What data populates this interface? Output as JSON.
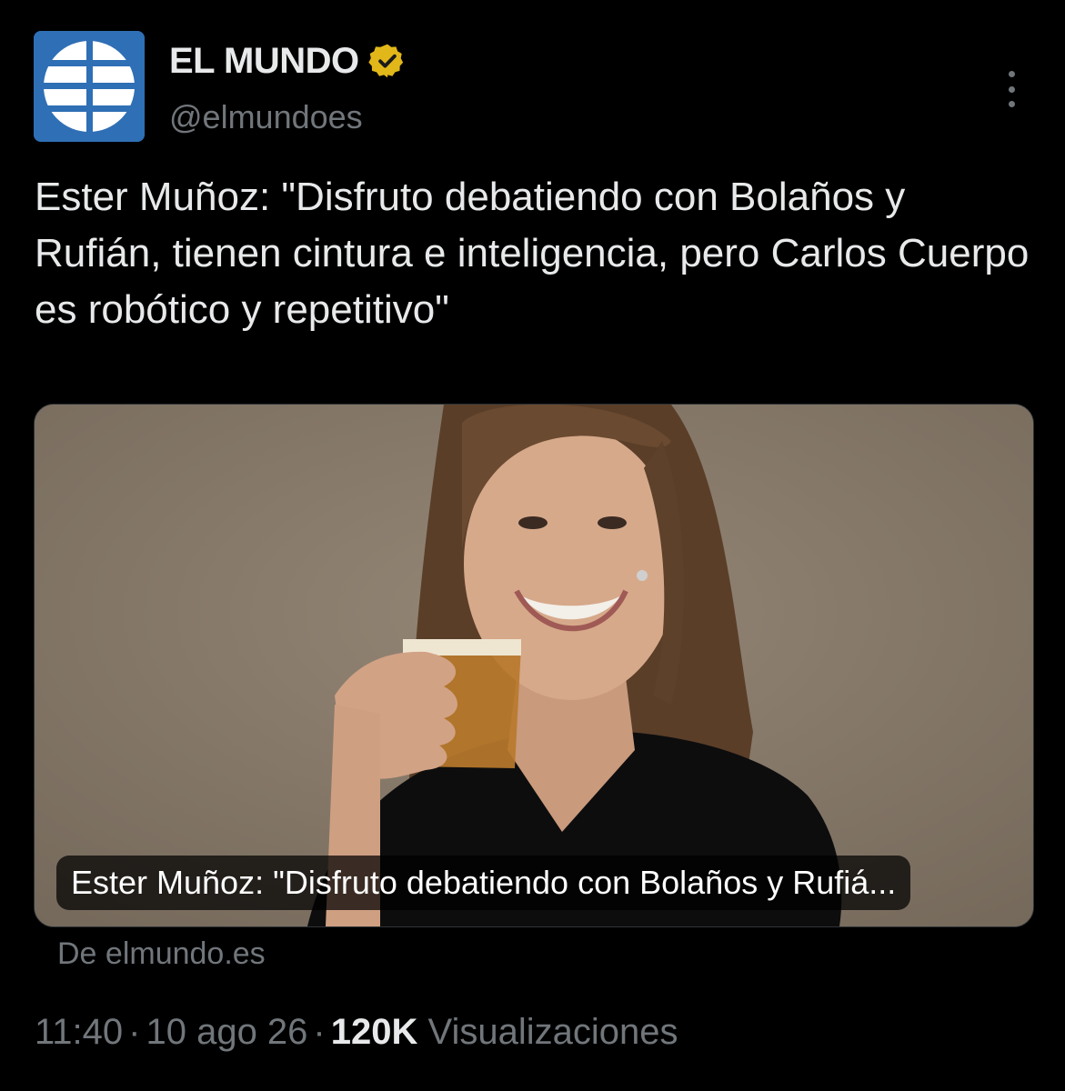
{
  "author": {
    "display_name": "EL MUNDO",
    "handle": "@elmundoes",
    "avatar_icon": "el-mundo-globe-logo",
    "verified_icon": "verified-badge-icon",
    "verified_color": "#e2b719"
  },
  "more_icon": "more-options-icon",
  "tweet": {
    "text": "Ester Muñoz: \"Disfruto debatiendo con Bolaños y Rufián, tienen cintura e inteligencia, pero Carlos Cuerpo es robótico y repetitivo\""
  },
  "card": {
    "title": "Ester Muñoz: \"Disfruto debatiendo con Bolaños y Rufiá...",
    "source": "De elmundo.es"
  },
  "meta": {
    "time": "11:40",
    "separator": "·",
    "date": "10 ago 26",
    "views_count": "120K",
    "views_label": "Visualizaciones"
  }
}
